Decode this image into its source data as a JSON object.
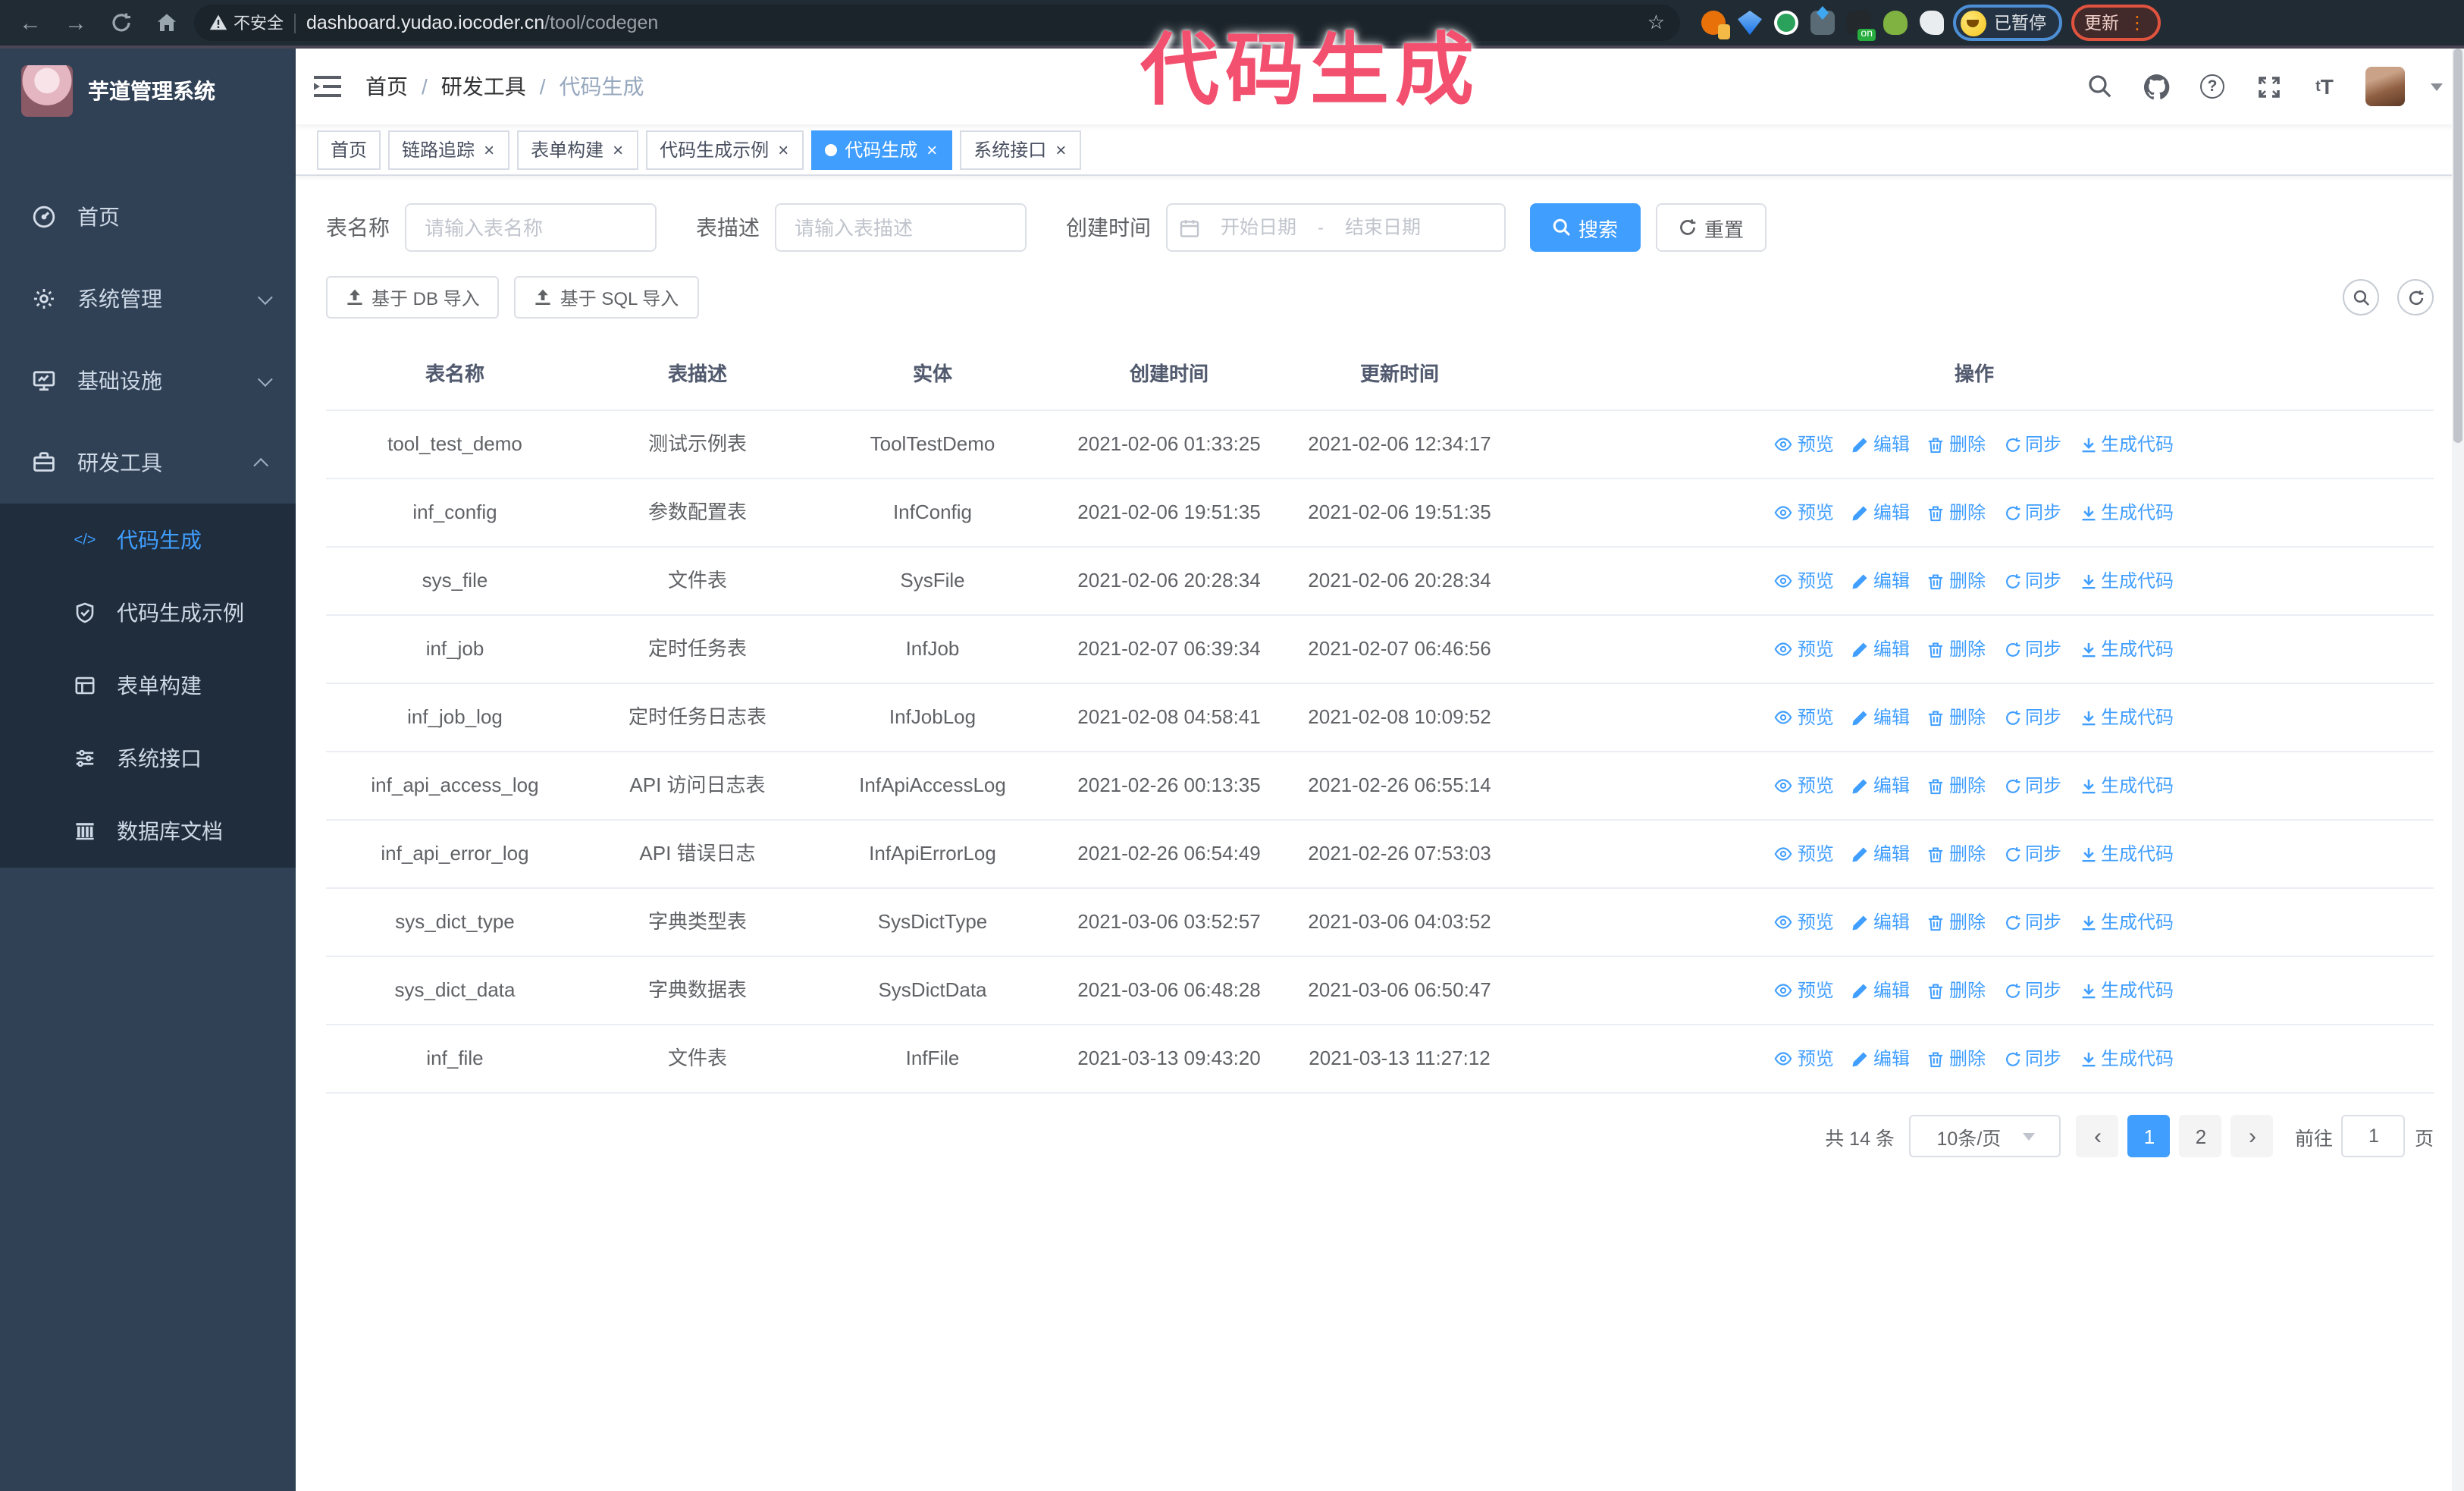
{
  "browser": {
    "security_label": "不安全",
    "url_host": "dashboard.yudao.iocoder.cn",
    "url_path": "/tool/codegen",
    "extension_on_badge": "on",
    "profile_badge": "已暂停",
    "update_button": "更新"
  },
  "annotation": {
    "text": "代码生成"
  },
  "colors": {
    "primary": "#409eff",
    "sidebar_bg": "#304156",
    "submenu_bg": "#1f2d3d",
    "annotation": "#f2506e",
    "browser_bar_bg": "#212b33",
    "active_tab_bg": "#409eff"
  },
  "sidebar": {
    "title": "芋道管理系统",
    "menu": [
      {
        "label": "首页",
        "icon": "dashboard-icon",
        "expand": null
      },
      {
        "label": "系统管理",
        "icon": "gear-icon",
        "expand": "down"
      },
      {
        "label": "基础设施",
        "icon": "infrastructure-icon",
        "expand": "down"
      },
      {
        "label": "研发工具",
        "icon": "toolbox-icon",
        "expand": "up"
      }
    ],
    "submenu": [
      {
        "label": "代码生成",
        "icon": "code-icon",
        "active": true
      },
      {
        "label": "代码生成示例",
        "icon": "shield-check-icon",
        "active": false
      },
      {
        "label": "表单构建",
        "icon": "form-icon",
        "active": false
      },
      {
        "label": "系统接口",
        "icon": "sliders-icon",
        "active": false
      },
      {
        "label": "数据库文档",
        "icon": "database-icon",
        "active": false
      }
    ]
  },
  "header": {
    "breadcrumb": [
      "首页",
      "研发工具",
      "代码生成"
    ]
  },
  "tabs": [
    {
      "label": "首页",
      "closable": false,
      "active": false
    },
    {
      "label": "链路追踪",
      "closable": true,
      "active": false
    },
    {
      "label": "表单构建",
      "closable": true,
      "active": false
    },
    {
      "label": "代码生成示例",
      "closable": true,
      "active": false
    },
    {
      "label": "代码生成",
      "closable": true,
      "active": true
    },
    {
      "label": "系统接口",
      "closable": true,
      "active": false
    }
  ],
  "filters": {
    "name_label": "表名称",
    "name_placeholder": "请输入表名称",
    "desc_label": "表描述",
    "desc_placeholder": "请输入表描述",
    "time_label": "创建时间",
    "start_placeholder": "开始日期",
    "range_separator": "-",
    "end_placeholder": "结束日期",
    "search_label": "搜索",
    "reset_label": "重置"
  },
  "toolbar": {
    "import_db_label": "基于 DB 导入",
    "import_sql_label": "基于 SQL 导入"
  },
  "table": {
    "columns": [
      "表名称",
      "表描述",
      "实体",
      "创建时间",
      "更新时间",
      "操作"
    ],
    "actions": [
      "预览",
      "编辑",
      "删除",
      "同步",
      "生成代码"
    ],
    "rows": [
      {
        "name": "tool_test_demo",
        "desc": "测试示例表",
        "entity": "ToolTestDemo",
        "created": "2021-02-06 01:33:25",
        "updated": "2021-02-06 12:34:17"
      },
      {
        "name": "inf_config",
        "desc": "参数配置表",
        "entity": "InfConfig",
        "created": "2021-02-06 19:51:35",
        "updated": "2021-02-06 19:51:35"
      },
      {
        "name": "sys_file",
        "desc": "文件表",
        "entity": "SysFile",
        "created": "2021-02-06 20:28:34",
        "updated": "2021-02-06 20:28:34"
      },
      {
        "name": "inf_job",
        "desc": "定时任务表",
        "entity": "InfJob",
        "created": "2021-02-07 06:39:34",
        "updated": "2021-02-07 06:46:56"
      },
      {
        "name": "inf_job_log",
        "desc": "定时任务日志表",
        "entity": "InfJobLog",
        "created": "2021-02-08 04:58:41",
        "updated": "2021-02-08 10:09:52"
      },
      {
        "name": "inf_api_access_log",
        "desc": "API 访问日志表",
        "entity": "InfApiAccessLog",
        "created": "2021-02-26 00:13:35",
        "updated": "2021-02-26 06:55:14"
      },
      {
        "name": "inf_api_error_log",
        "desc": "API 错误日志",
        "entity": "InfApiErrorLog",
        "created": "2021-02-26 06:54:49",
        "updated": "2021-02-26 07:53:03"
      },
      {
        "name": "sys_dict_type",
        "desc": "字典类型表",
        "entity": "SysDictType",
        "created": "2021-03-06 03:52:57",
        "updated": "2021-03-06 04:03:52"
      },
      {
        "name": "sys_dict_data",
        "desc": "字典数据表",
        "entity": "SysDictData",
        "created": "2021-03-06 06:48:28",
        "updated": "2021-03-06 06:50:47"
      },
      {
        "name": "inf_file",
        "desc": "文件表",
        "entity": "InfFile",
        "created": "2021-03-13 09:43:20",
        "updated": "2021-03-13 11:27:12"
      }
    ]
  },
  "pagination": {
    "total": "共 14 条",
    "page_size": "10条/页",
    "pages": [
      "1",
      "2"
    ],
    "current": "1",
    "goto_label": "前往",
    "goto_value": "1",
    "page_unit": "页"
  }
}
